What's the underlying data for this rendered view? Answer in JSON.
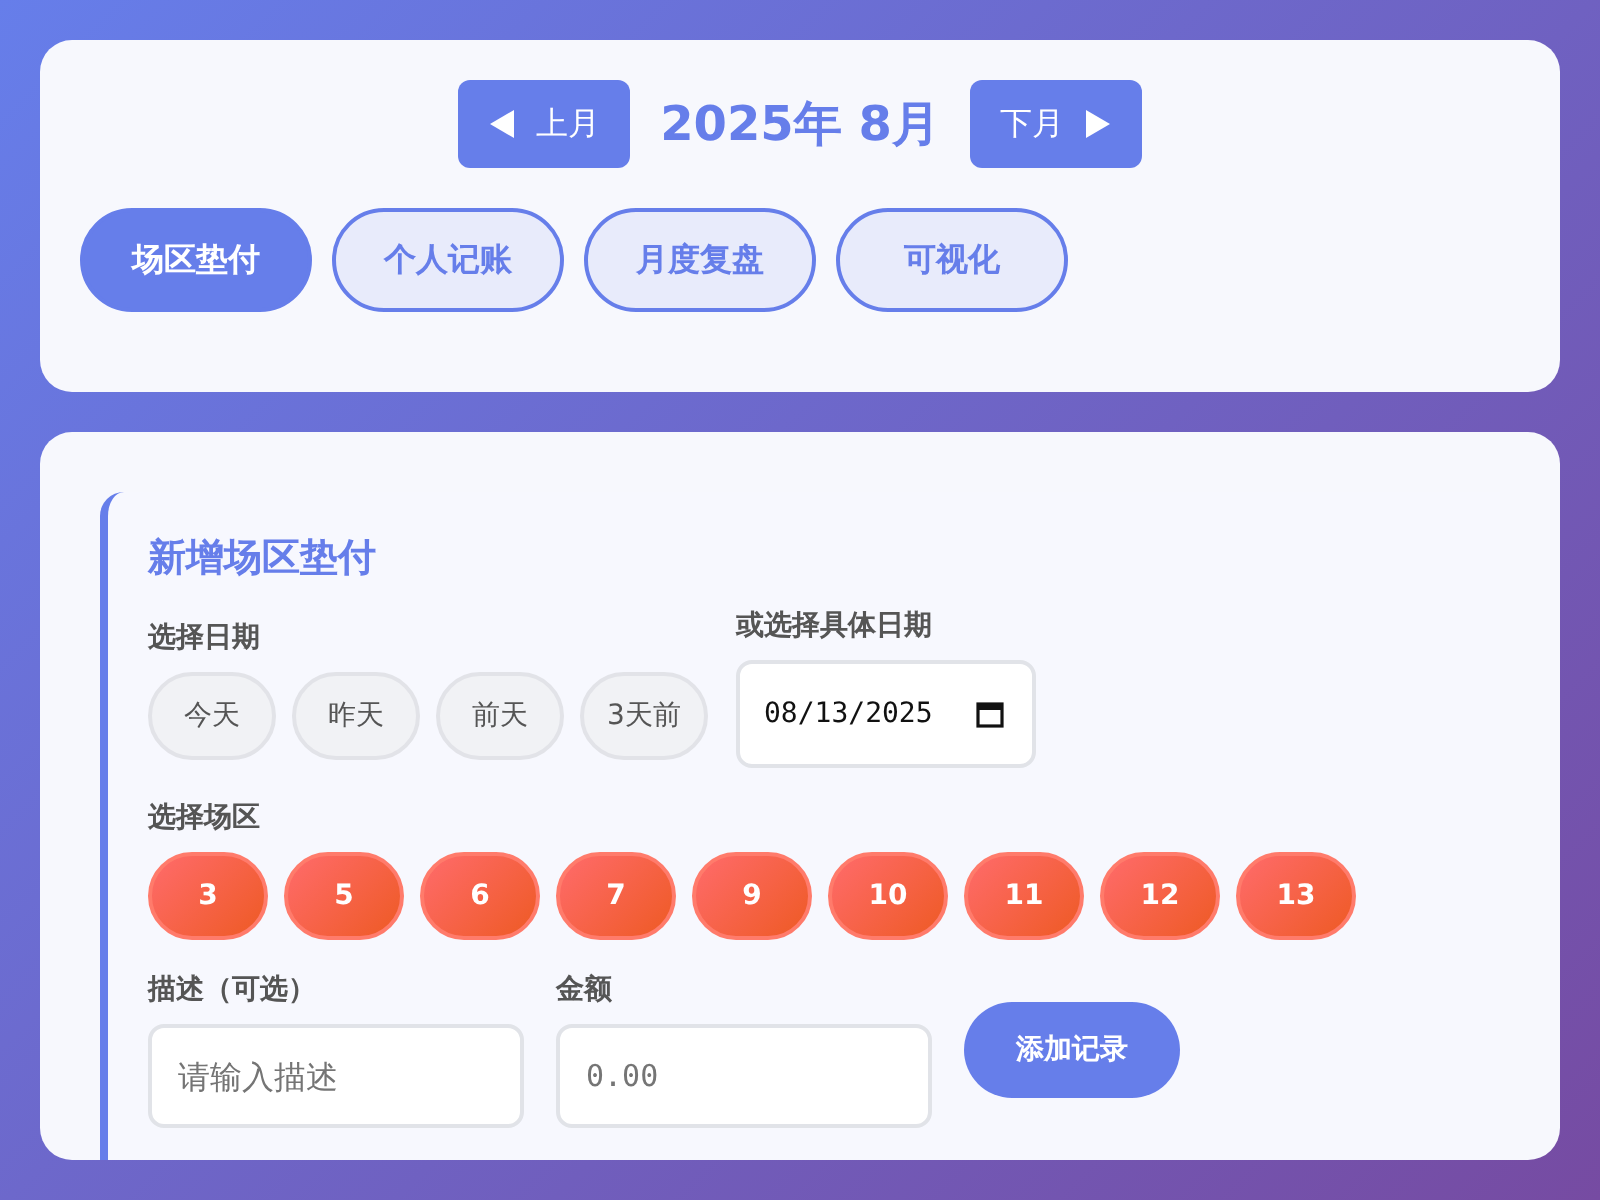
{
  "month_nav": {
    "prev": "上月",
    "title": "2025年 8月",
    "next": "下月"
  },
  "tabs": [
    {
      "label": "场区垫付",
      "selected": true
    },
    {
      "label": "个人记账",
      "selected": false
    },
    {
      "label": "月度复盘",
      "selected": false
    },
    {
      "label": "可视化",
      "selected": false
    }
  ],
  "form": {
    "title": "新增场区垫付",
    "date_label": "选择日期",
    "quick_dates": [
      "今天",
      "昨天",
      "前天",
      "3天前"
    ],
    "specific_date_label": "或选择具体日期",
    "specific_date": "08/13/2025",
    "venue_label": "选择场区",
    "venues": [
      "3",
      "5",
      "6",
      "7",
      "9",
      "10",
      "11",
      "12",
      "13"
    ],
    "description_label": "描述（可选）",
    "description_placeholder": "请输入描述",
    "amount_label": "金额",
    "amount_placeholder": "0.00",
    "submit": "添加记录"
  }
}
